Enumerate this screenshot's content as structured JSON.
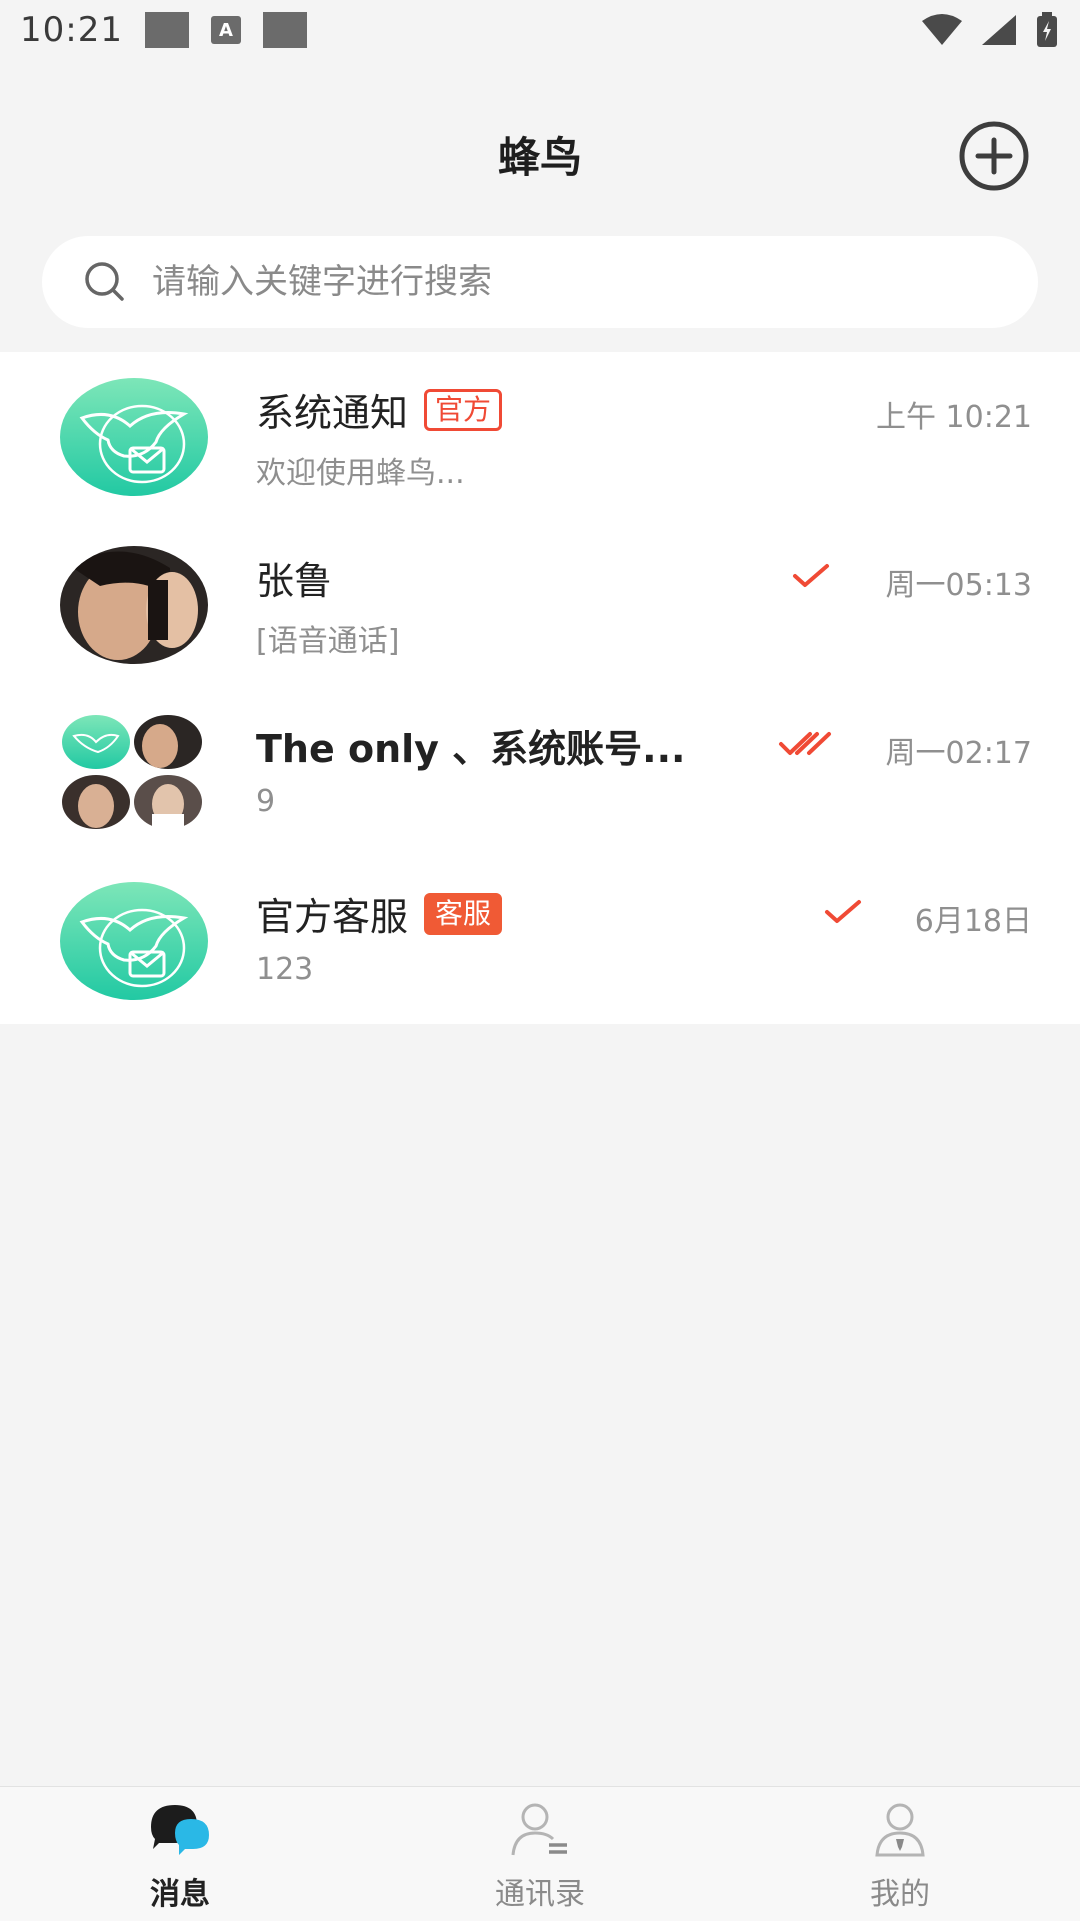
{
  "status_bar": {
    "time": "10:21",
    "notif_a": "A"
  },
  "header": {
    "title": "蜂鸟"
  },
  "search": {
    "placeholder": "请输入关键字进行搜索"
  },
  "conversations": [
    {
      "name": "系统通知",
      "badge": "官方",
      "preview": "欢迎使用蜂鸟...",
      "time": "上午 10:21",
      "read_state": "none"
    },
    {
      "name": "张鲁",
      "badge": "",
      "preview": "[语音通话]",
      "time": "周一05:13",
      "read_state": "sent"
    },
    {
      "name": "The only 、系统账号...",
      "badge": "",
      "preview": "9",
      "time": "周一02:17",
      "read_state": "read"
    },
    {
      "name": "官方客服",
      "badge": "客服",
      "preview": "123",
      "time": "6月18日",
      "read_state": "sent"
    }
  ],
  "tabs": [
    {
      "label": "消息",
      "active": true,
      "icon": "chat-bubbles-icon"
    },
    {
      "label": "通讯录",
      "active": false,
      "icon": "contacts-icon"
    },
    {
      "label": "我的",
      "active": false,
      "icon": "profile-icon"
    }
  ],
  "colors": {
    "accent": "#f04a35",
    "teal_avatar": "#3dd6a8",
    "background": "#f4f4f4"
  }
}
